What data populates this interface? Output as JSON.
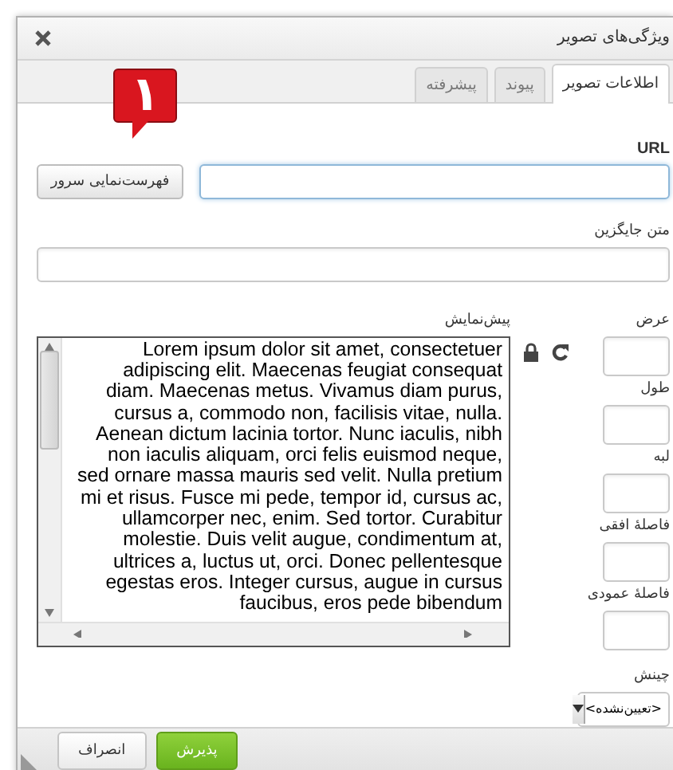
{
  "dialog": {
    "title": "ویژگی‌های تصویر"
  },
  "tabs": [
    {
      "label": "اطلاعات تصویر",
      "selected": true
    },
    {
      "label": "پیوند",
      "selected": false
    },
    {
      "label": "پیشرفته",
      "selected": false
    }
  ],
  "callout": {
    "number": "۱"
  },
  "url": {
    "label": "URL",
    "browse_button": "فهرست‌نمایی سرور"
  },
  "alt_text": {
    "label": "متن جایگزین"
  },
  "preview": {
    "label": "پیش‌نمایش",
    "text": "Lorem ipsum dolor sit amet, consectetuer adipiscing elit. Maecenas feugiat consequat diam. Maecenas metus. Vivamus diam purus, cursus a, commodo non, facilisis vitae, nulla. Aenean dictum lacinia tortor. Nunc iaculis, nibh non iaculis aliquam, orci felis euismod neque, sed ornare massa mauris sed velit. Nulla pretium mi et risus. Fusce mi pede, tempor id, cursus ac, ullamcorper nec, enim. Sed tortor. Curabitur molestie. Duis velit augue, condimentum at, ultrices a, luctus ut, orci. Donec pellentesque egestas eros. Integer cursus, augue in cursus faucibus, eros pede bibendum"
  },
  "size_fields": [
    {
      "label": "عرض"
    },
    {
      "label": "طول"
    },
    {
      "label": "لبه"
    },
    {
      "label": "فاصلهٔ افقی"
    },
    {
      "label": "فاصلهٔ عمودی"
    }
  ],
  "align": {
    "label": "چینش",
    "value": "<تعیین‌نشده>"
  },
  "buttons": [
    {
      "label": "پذیرش",
      "kind": "primary"
    },
    {
      "label": "انصراف",
      "kind": "secondary"
    }
  ]
}
